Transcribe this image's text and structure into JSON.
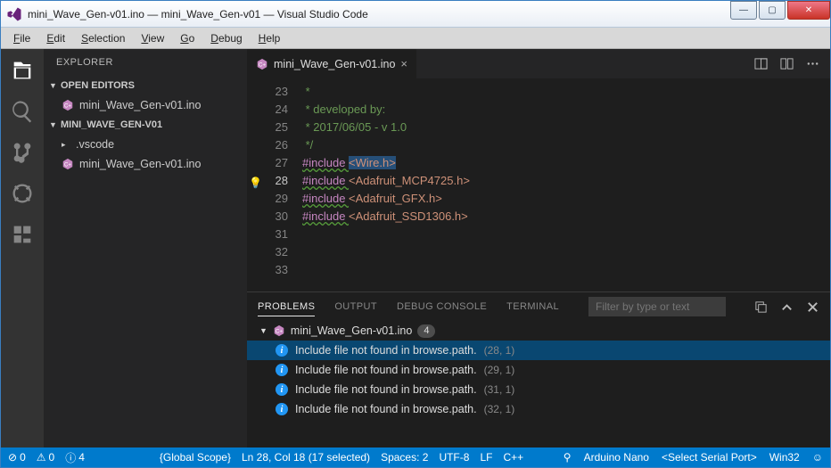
{
  "window": {
    "title": "mini_Wave_Gen-v01.ino — mini_Wave_Gen-v01 — Visual Studio Code"
  },
  "menu": {
    "file": "File",
    "edit": "Edit",
    "selection": "Selection",
    "view": "View",
    "go": "Go",
    "debug": "Debug",
    "help": "Help"
  },
  "sidebar": {
    "title": "EXPLORER",
    "open_editors_label": "OPEN EDITORS",
    "open_editors": [
      {
        "name": "mini_Wave_Gen-v01.ino"
      }
    ],
    "project_label": "MINI_WAVE_GEN-V01",
    "items": [
      {
        "name": ".vscode",
        "type": "folder"
      },
      {
        "name": "mini_Wave_Gen-v01.ino",
        "type": "file"
      }
    ]
  },
  "tab": {
    "name": "mini_Wave_Gen-v01.ino"
  },
  "editor": {
    "lines": [
      {
        "n": 23,
        "segments": [
          {
            "t": " *",
            "cls": "c-comment"
          }
        ]
      },
      {
        "n": 24,
        "segments": [
          {
            "t": " * developed by:",
            "cls": "c-comment"
          }
        ]
      },
      {
        "n": 25,
        "segments": [
          {
            "t": " * 2017/06/05 - v 1.0",
            "cls": "c-comment"
          }
        ]
      },
      {
        "n": 26,
        "segments": [
          {
            "t": " */",
            "cls": "c-comment"
          }
        ]
      },
      {
        "n": 27,
        "segments": [
          {
            "t": "",
            "cls": ""
          }
        ]
      },
      {
        "n": 28,
        "active": true,
        "segments": [
          {
            "t": "#include ",
            "cls": "c-macro wavy"
          },
          {
            "t": "<Wire.h>",
            "cls": "c-string selbg"
          }
        ]
      },
      {
        "n": 29,
        "segments": [
          {
            "t": "#include ",
            "cls": "c-macro wavy"
          },
          {
            "t": "<Adafruit_MCP4725.h>",
            "cls": "c-string"
          }
        ]
      },
      {
        "n": 30,
        "segments": [
          {
            "t": "",
            "cls": ""
          }
        ]
      },
      {
        "n": 31,
        "segments": [
          {
            "t": "#include ",
            "cls": "c-macro wavy"
          },
          {
            "t": "<Adafruit_GFX.h>",
            "cls": "c-string"
          }
        ]
      },
      {
        "n": 32,
        "segments": [
          {
            "t": "#include ",
            "cls": "c-macro wavy"
          },
          {
            "t": "<Adafruit_SSD1306.h>",
            "cls": "c-string"
          }
        ]
      },
      {
        "n": 33,
        "segments": [
          {
            "t": "",
            "cls": ""
          }
        ]
      }
    ]
  },
  "panel": {
    "tabs": {
      "problems": "PROBLEMS",
      "output": "OUTPUT",
      "debug": "DEBUG CONSOLE",
      "terminal": "TERMINAL"
    },
    "filter_placeholder": "Filter by type or text",
    "file": "mini_Wave_Gen-v01.ino",
    "count": "4",
    "problems": [
      {
        "msg": "Include file not found in browse.path.",
        "loc": "(28, 1)",
        "selected": true
      },
      {
        "msg": "Include file not found in browse.path.",
        "loc": "(29, 1)"
      },
      {
        "msg": "Include file not found in browse.path.",
        "loc": "(31, 1)"
      },
      {
        "msg": "Include file not found in browse.path.",
        "loc": "(32, 1)"
      }
    ]
  },
  "status": {
    "errors": "0",
    "warnings": "0",
    "infos": "4",
    "scope": "{Global Scope}",
    "cursor": "Ln 28, Col 18 (17 selected)",
    "spaces": "Spaces: 2",
    "encoding": "UTF-8",
    "eol": "LF",
    "lang": "C++",
    "board": "Arduino Nano",
    "port": "<Select Serial Port>",
    "win": "Win32"
  }
}
